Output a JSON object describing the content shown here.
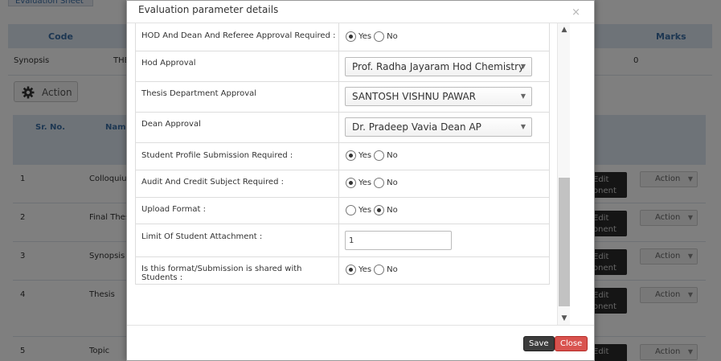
{
  "background": {
    "tab_label": "Evaluation Sheet",
    "table1_headers": [
      "Code",
      "Marks"
    ],
    "table1_row": [
      "Synopsis",
      "THE",
      "0"
    ],
    "action_button": "Action",
    "table2_headers": [
      "Sr. No.",
      "Name"
    ],
    "rows": [
      {
        "sr": "1",
        "name": "Colloquium"
      },
      {
        "sr": "2",
        "name": "Final Thes"
      },
      {
        "sr": "3",
        "name": "Synopsis"
      },
      {
        "sr": "4",
        "name": "Thesis"
      },
      {
        "sr": "5",
        "name": "Topic"
      }
    ],
    "edit_label_1": "Edit",
    "edit_label_2": "onent",
    "row_action": "Action"
  },
  "modal": {
    "title": "Evaluation parameter details",
    "close_symbol": "×",
    "fields": [
      {
        "label": "HOD And Dean And Referee Approval Required :",
        "type": "radio",
        "selected": "Yes"
      },
      {
        "label": "Hod Approval",
        "type": "select",
        "value": "Prof. Radha Jayaram Hod Chemistry"
      },
      {
        "label": "Thesis Department Approval",
        "type": "select",
        "value": "SANTOSH VISHNU PAWAR"
      },
      {
        "label": "Dean Approval",
        "type": "select",
        "value": "Dr. Pradeep Vavia Dean AP"
      },
      {
        "label": "Student Profile Submission Required :",
        "type": "radio",
        "selected": "Yes"
      },
      {
        "label": "Audit And Credit Subject Required :",
        "type": "radio",
        "selected": "Yes"
      },
      {
        "label": "Upload Format :",
        "type": "radio",
        "selected": "No"
      },
      {
        "label": "Limit Of Student Attachment :",
        "type": "text",
        "value": "1"
      },
      {
        "label": "Is this format/Submission is shared with Students :",
        "type": "radio",
        "selected": "Yes"
      }
    ],
    "radio_yes": "Yes",
    "radio_no": "No",
    "save_label": "Save",
    "close_label": "Close"
  }
}
